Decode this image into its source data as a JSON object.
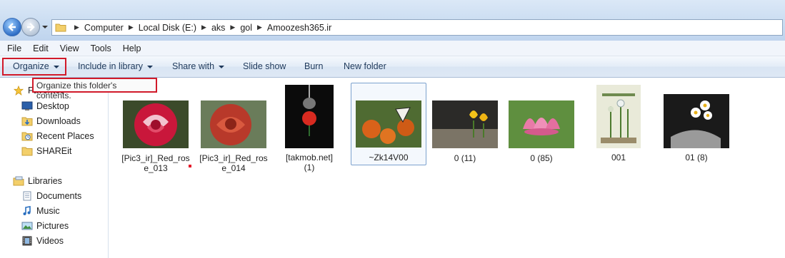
{
  "breadcrumb": [
    "Computer",
    "Local Disk (E:)",
    "aks",
    "gol",
    "Amoozesh365.ir"
  ],
  "menu": [
    "File",
    "Edit",
    "View",
    "Tools",
    "Help"
  ],
  "toolbar": {
    "organize": "Organize",
    "include": "Include in library",
    "share": "Share with",
    "slideshow": "Slide show",
    "burn": "Burn",
    "newfolder": "New folder"
  },
  "tooltip": "Organize this folder's contents.",
  "nav": {
    "favorites": "Favorites",
    "fav_items": [
      "Desktop",
      "Downloads",
      "Recent Places",
      "SHAREit"
    ],
    "libraries": "Libraries",
    "lib_items": [
      "Documents",
      "Music",
      "Pictures",
      "Videos"
    ]
  },
  "files": [
    {
      "name_line1": "[Pic3_ir]_Red_ros",
      "name_line2": "e_013"
    },
    {
      "name_line1": "[Pic3_ir]_Red_ros",
      "name_line2": "e_014"
    },
    {
      "name_line1": "[takmob.net](1)",
      "name_line2": ""
    },
    {
      "name_line1": "~Zk14V00",
      "name_line2": ""
    },
    {
      "name_line1": "0 (11)",
      "name_line2": ""
    },
    {
      "name_line1": "0 (85)",
      "name_line2": ""
    },
    {
      "name_line1": "001",
      "name_line2": ""
    },
    {
      "name_line1": "01 (8)",
      "name_line2": ""
    }
  ],
  "colors": {
    "highlight": "#d11a2a",
    "accent": "#1e395b"
  }
}
